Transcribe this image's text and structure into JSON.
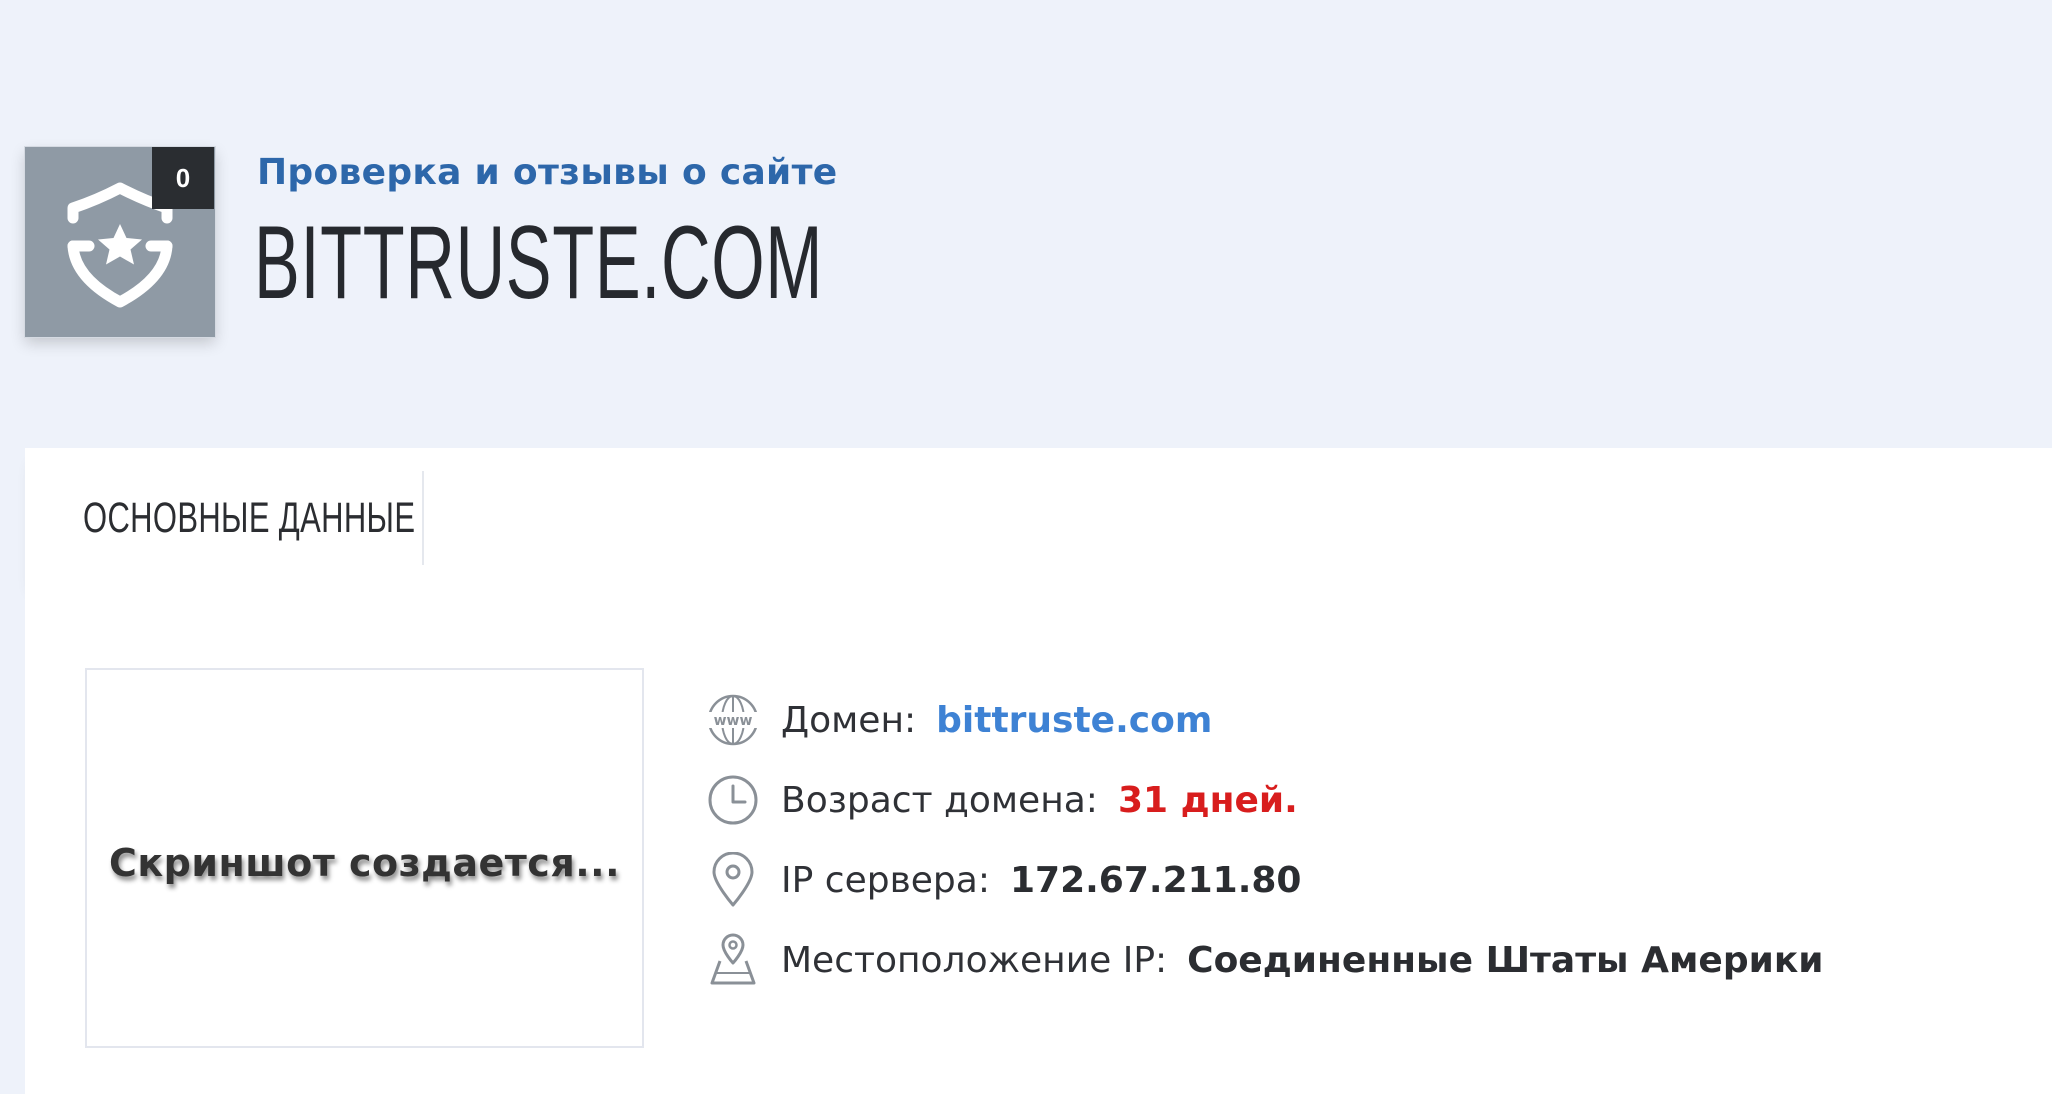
{
  "header": {
    "subtitle": "Проверка и отзывы о сайте",
    "site_name": "BITTRUSTE.COM",
    "review_count": "0",
    "badge_icon": "shield-star-icon"
  },
  "tabs": [
    {
      "label": "ОСНОВНЫЕ ДАННЫЕ",
      "active": true
    }
  ],
  "screenshot": {
    "placeholder_text": "Скриншот создается..."
  },
  "info": {
    "domain": {
      "label": "Домен:",
      "value": "bittruste.com",
      "icon": "www-globe-icon"
    },
    "age": {
      "label": "Возраст домена:",
      "value": "31 дней.",
      "icon": "clock-icon"
    },
    "ip": {
      "label": "IP сервера:",
      "value": "172.67.211.80",
      "icon": "location-pin-icon"
    },
    "location": {
      "label": "Местоположение IP:",
      "value": "Соединенные Штаты Америки",
      "icon": "map-pin-icon"
    }
  },
  "colors": {
    "background": "#eef2fa",
    "accent_blue": "#2d67aa",
    "link_blue": "#3e82d4",
    "age_red": "#d81d1d",
    "badge_gray": "#8f9aa5",
    "counter_dark": "#2a2d31"
  }
}
